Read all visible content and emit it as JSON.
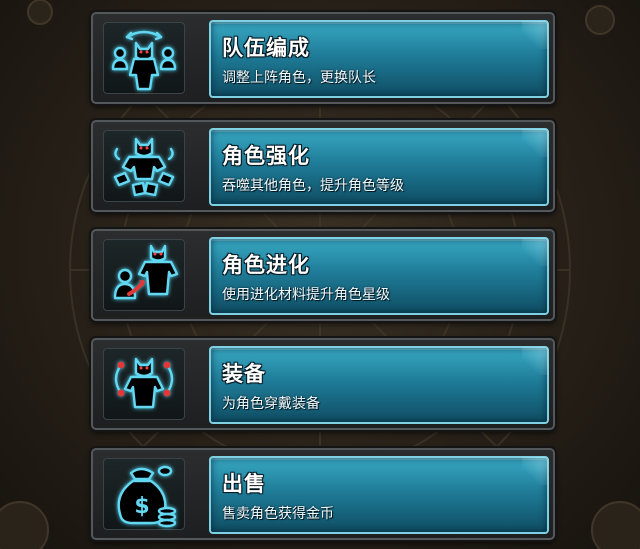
{
  "menu": {
    "items": [
      {
        "title": "队伍编成",
        "desc": "调整上阵角色，更换队长",
        "icon": "team-formation-icon"
      },
      {
        "title": "角色强化",
        "desc": "吞噬其他角色，提升角色等级",
        "icon": "character-enhance-icon"
      },
      {
        "title": "角色进化",
        "desc": "使用进化材料提升角色星级",
        "icon": "character-evolve-icon"
      },
      {
        "title": "装备",
        "desc": "为角色穿戴装备",
        "icon": "equipment-icon"
      },
      {
        "title": "出售",
        "desc": "售卖角色获得金币",
        "icon": "sell-money-bag-icon"
      }
    ]
  },
  "colors": {
    "panel_accent": "#2a8fae",
    "icon_glow": "#63d8f2",
    "background": "#2a231a"
  }
}
